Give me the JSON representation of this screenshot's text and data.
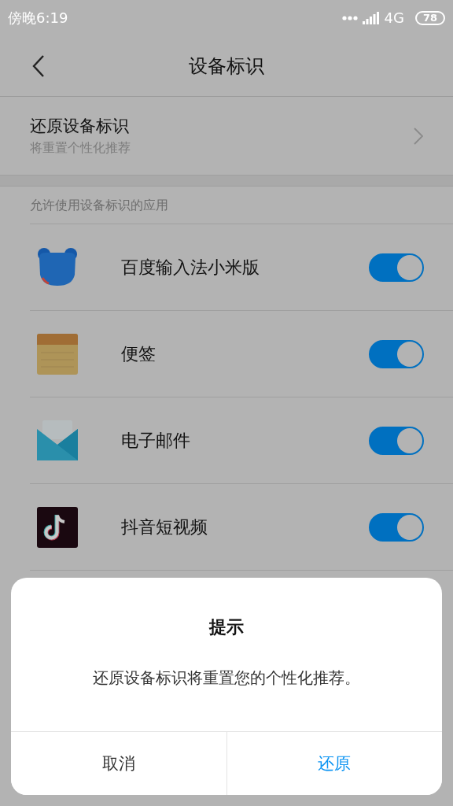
{
  "status_bar": {
    "time": "傍晚6:19",
    "network": "4G",
    "battery": "78"
  },
  "header": {
    "title": "设备标识"
  },
  "reset_row": {
    "title": "还原设备标识",
    "subtitle": "将重置个性化推荐"
  },
  "section": {
    "title": "允许使用设备标识的应用"
  },
  "apps": [
    {
      "name": "百度输入法小米版",
      "kind": "bear",
      "on": true
    },
    {
      "name": "便签",
      "kind": "notepad",
      "on": true
    },
    {
      "name": "电子邮件",
      "kind": "mail",
      "on": true
    },
    {
      "name": "抖音短视频",
      "kind": "note",
      "on": true
    }
  ],
  "dialog": {
    "title": "提示",
    "message": "还原设备标识将重置您的个性化推荐。",
    "buttons": [
      {
        "label": "取消",
        "kind": "cancel"
      },
      {
        "label": "还原",
        "kind": "confirm"
      }
    ]
  }
}
